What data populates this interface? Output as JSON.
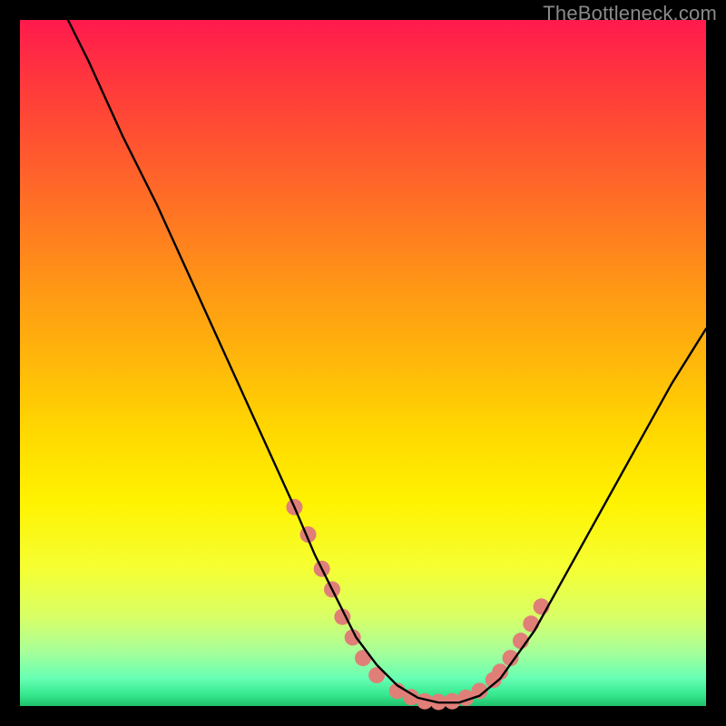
{
  "watermark": "TheBottleneck.com",
  "chart_data": {
    "type": "line",
    "title": "",
    "xlabel": "",
    "ylabel": "",
    "xlim": [
      0,
      100
    ],
    "ylim": [
      0,
      100
    ],
    "grid": false,
    "legend": false,
    "background_gradient": {
      "direction": "vertical",
      "stops": [
        {
          "pos": 0,
          "color": "#ff1a4d"
        },
        {
          "pos": 50,
          "color": "#ffd800"
        },
        {
          "pos": 80,
          "color": "#f5ff33"
        },
        {
          "pos": 100,
          "color": "#1fbf6a"
        }
      ]
    },
    "series": [
      {
        "name": "bottleneck-curve",
        "color": "#000000",
        "x": [
          7,
          10,
          15,
          20,
          25,
          30,
          35,
          40,
          43,
          46,
          49,
          52,
          55,
          58,
          61,
          64,
          67,
          70,
          75,
          80,
          85,
          90,
          95,
          100
        ],
        "values": [
          100,
          94,
          83,
          73,
          62,
          51,
          40,
          29,
          22,
          16,
          10,
          6,
          3,
          1.2,
          0.5,
          0.5,
          1.5,
          4,
          11,
          20,
          29,
          38,
          47,
          55
        ]
      }
    ],
    "markers": {
      "name": "highlight-dots",
      "color": "#e07f78",
      "radius": 9,
      "points": [
        {
          "x": 40,
          "y": 29
        },
        {
          "x": 42,
          "y": 25
        },
        {
          "x": 44,
          "y": 20
        },
        {
          "x": 45.5,
          "y": 17
        },
        {
          "x": 47,
          "y": 13
        },
        {
          "x": 48.5,
          "y": 10
        },
        {
          "x": 50,
          "y": 7
        },
        {
          "x": 52,
          "y": 4.5
        },
        {
          "x": 55,
          "y": 2.2
        },
        {
          "x": 57,
          "y": 1.3
        },
        {
          "x": 59,
          "y": 0.7
        },
        {
          "x": 61,
          "y": 0.6
        },
        {
          "x": 63,
          "y": 0.7
        },
        {
          "x": 65,
          "y": 1.2
        },
        {
          "x": 67,
          "y": 2.2
        },
        {
          "x": 69,
          "y": 3.8
        },
        {
          "x": 70,
          "y": 5
        },
        {
          "x": 71.5,
          "y": 7
        },
        {
          "x": 73,
          "y": 9.5
        },
        {
          "x": 74.5,
          "y": 12
        },
        {
          "x": 76,
          "y": 14.5
        }
      ]
    }
  }
}
